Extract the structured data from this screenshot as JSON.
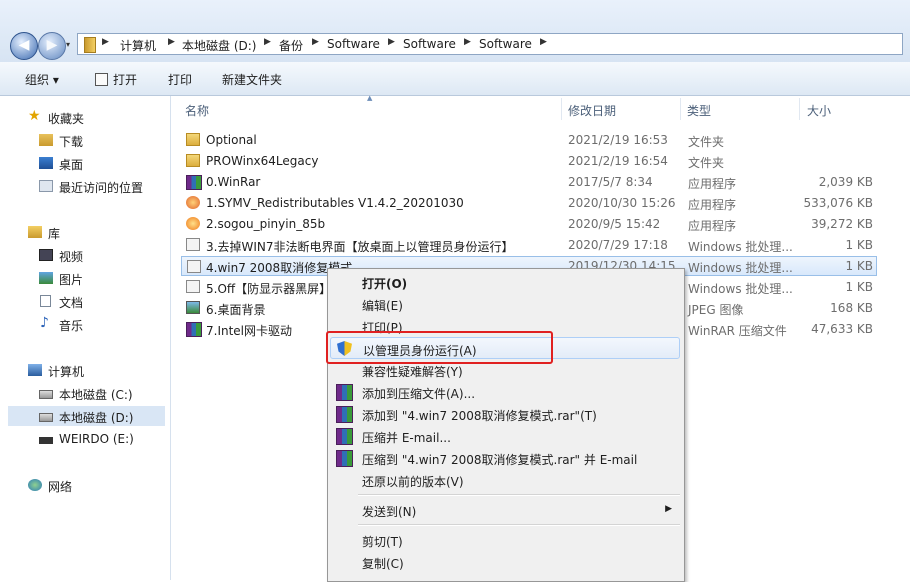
{
  "address": {
    "crumbs": [
      "计算机",
      "本地磁盘 (D:)",
      "备份",
      "Software",
      "Software",
      "Software"
    ]
  },
  "toolbar": {
    "organize": "组织 ▾",
    "open": "打开",
    "print": "打印",
    "new_folder": "新建文件夹"
  },
  "nav": {
    "favorites": "收藏夹",
    "downloads": "下载",
    "desktop": "桌面",
    "recent": "最近访问的位置",
    "libraries": "库",
    "videos": "视频",
    "pictures": "图片",
    "documents": "文档",
    "music": "音乐",
    "computer": "计算机",
    "drive_c": "本地磁盘 (C:)",
    "drive_d": "本地磁盘 (D:)",
    "drive_e": "WEIRDO (E:)",
    "network": "网络"
  },
  "columns": {
    "name": "名称",
    "modified": "修改日期",
    "type": "类型",
    "size": "大小"
  },
  "files": [
    {
      "name": "Optional",
      "modified": "2021/2/19 16:53",
      "type": "文件夹",
      "size": ""
    },
    {
      "name": "PROWinx64Legacy",
      "modified": "2021/2/19 16:54",
      "type": "文件夹",
      "size": ""
    },
    {
      "name": "0.WinRar",
      "modified": "2017/5/7 8:34",
      "type": "应用程序",
      "size": "2,039 KB"
    },
    {
      "name": "1.SYMV_Redistributables V1.4.2_20201030",
      "modified": "2020/10/30 15:26",
      "type": "应用程序",
      "size": "533,076 KB"
    },
    {
      "name": "2.sogou_pinyin_85b",
      "modified": "2020/9/5 15:42",
      "type": "应用程序",
      "size": "39,272 KB"
    },
    {
      "name": "3.去掉WIN7非法断电界面【放桌面上以管理员身份运行】",
      "modified": "2020/7/29 17:18",
      "type": "Windows 批处理...",
      "size": "1 KB"
    },
    {
      "name": "4.win7 2008取消修复模式",
      "modified": "2019/12/30 14:15",
      "type": "Windows 批处理...",
      "size": "1 KB"
    },
    {
      "name": "5.Off【防显示器黑屏】",
      "modified": "",
      "type": "Windows 批处理...",
      "size": "1 KB"
    },
    {
      "name": "6.桌面背景",
      "modified": "",
      "type": "JPEG 图像",
      "size": "168 KB"
    },
    {
      "name": "7.Intel网卡驱动",
      "modified": "",
      "type": "WinRAR 压缩文件",
      "size": "47,633 KB"
    }
  ],
  "context_menu": {
    "open": "打开(O)",
    "edit": "编辑(E)",
    "print": "打印(P)",
    "run_as_admin": "以管理员身份运行(A)",
    "compat": "兼容性疑难解答(Y)",
    "add_archive": "添加到压缩文件(A)...",
    "add_named": "添加到 \"4.win7 2008取消修复模式.rar\"(T)",
    "compress_email": "压缩并 E-mail...",
    "compress_named_email": "压缩到 \"4.win7 2008取消修复模式.rar\" 并 E-mail",
    "restore": "还原以前的版本(V)",
    "send_to": "发送到(N)",
    "cut": "剪切(T)",
    "copy": "复制(C)"
  },
  "colors": {
    "highlight_box": "#e02020",
    "selection": "#d8e8fb"
  }
}
